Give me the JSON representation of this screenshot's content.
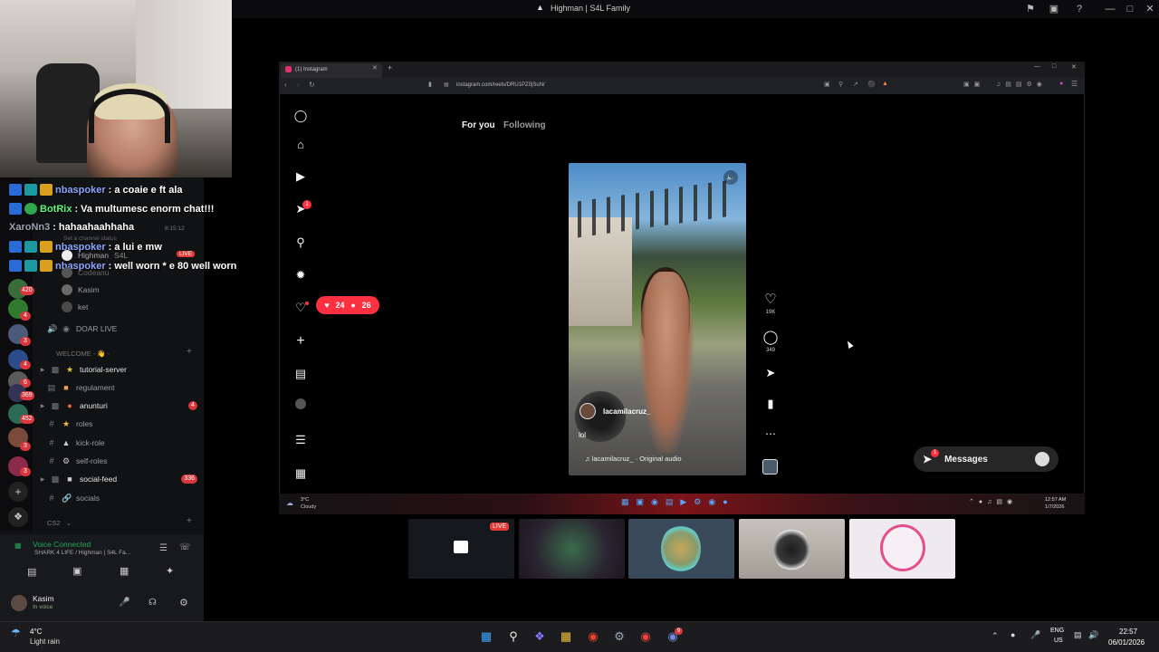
{
  "window": {
    "title": "Highman | S4L Family"
  },
  "chat_overlay": [
    {
      "user": "nbaspoker",
      "message": "a coaie e ft ala",
      "color": "blue"
    },
    {
      "user": "BotRix",
      "message": "Va multumesc enorm chat!!!",
      "color": "green"
    },
    {
      "user": "XaroNn3",
      "message": "hahaahaahhaha",
      "color": "grey"
    },
    {
      "user": "nbaspoker",
      "message": "a lui e mw",
      "color": "blue"
    },
    {
      "user": "nbaspoker",
      "message": "well worn * e 80 well worn",
      "color": "blue"
    }
  ],
  "discord": {
    "status_time": "8:15:12",
    "status_hint": "Set a channel status",
    "voice_members": [
      {
        "name": "Highman",
        "tag": "S4L",
        "badge": "LIVE"
      },
      {
        "name": "Codeanu"
      },
      {
        "name": "Kasim"
      },
      {
        "name": "ket"
      }
    ],
    "channel_doar_live": "DOAR LIVE",
    "category_welcome": "WELCOME - 👋 -",
    "channels": [
      {
        "name": "tutorial-server",
        "bright": true
      },
      {
        "name": "regulament",
        "bright": false
      },
      {
        "name": "anunturi",
        "bright": true,
        "badge": "4"
      },
      {
        "name": "roles",
        "bright": false
      },
      {
        "name": "kick-role",
        "bright": false
      },
      {
        "name": "self-roles",
        "bright": false
      },
      {
        "name": "social-feed",
        "bright": true,
        "badge": "336"
      },
      {
        "name": "socials",
        "bright": false
      }
    ],
    "category_cs2": "CS2",
    "server_badges": [
      "420",
      "4",
      "3",
      "4",
      "6",
      "369",
      "452",
      "3",
      "3",
      "4"
    ],
    "voice_status": "Voice Connected",
    "voice_channel": "SHARK 4 LIFE / Highman | S4L Fa...",
    "user_name": "Kasim",
    "user_status": "In voice"
  },
  "browser": {
    "tab_title": "(1) Instagram",
    "url": "instagram.com/reels/DRU1PZ0jSuN/",
    "feed_tabs": {
      "for_you": "For you",
      "following": "Following"
    },
    "notification_count": "1",
    "like_pill": {
      "likes": "24",
      "followers": "26"
    },
    "video": {
      "username": "lacamilacruz_",
      "caption": "lol",
      "audio": "lacamilacruz_ · Original audio"
    },
    "actions": {
      "likes": "19K",
      "comments": "349"
    },
    "messages_label": "Messages",
    "messages_badge": "1",
    "inner_taskbar": {
      "weather_temp": "3°C",
      "weather_desc": "Cloudy",
      "time": "12:57 AM",
      "date": "1/7/2026"
    }
  },
  "thumbnails": [
    {
      "badge": "LIVE"
    },
    {},
    {},
    {},
    {}
  ],
  "taskbar": {
    "weather_temp": "4°C",
    "weather_desc": "Light rain",
    "lang_line1": "ENG",
    "lang_line2": "US",
    "time": "22:57",
    "date": "06/01/2026",
    "discord_badge": "9"
  },
  "colors": {
    "discord_bg": "#111214",
    "accent_red": "#ff3040",
    "voice_green": "#23a55a",
    "live_red": "#e53935"
  }
}
